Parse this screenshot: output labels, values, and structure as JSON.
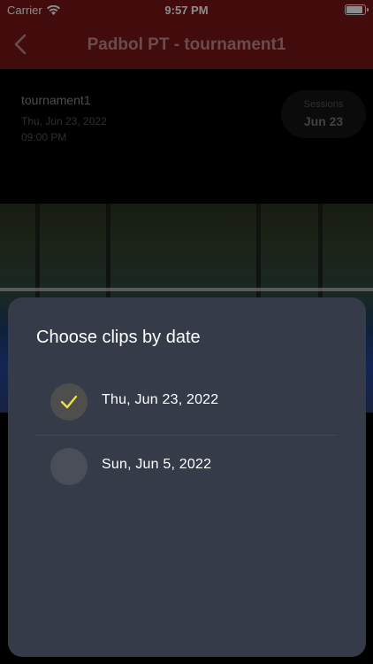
{
  "status_bar": {
    "carrier": "Carrier",
    "time": "9:57 PM"
  },
  "nav": {
    "title": "Padbol PT - tournament1"
  },
  "tournament": {
    "name": "tournament1",
    "date": "Thu, Jun 23, 2022",
    "time": "09:00 PM"
  },
  "sessions": {
    "label": "Sessions",
    "value": "Jun 23"
  },
  "modal": {
    "title": "Choose clips by date",
    "options": [
      {
        "date": "Thu, Jun 23, 2022",
        "selected": true
      },
      {
        "date": "Sun, Jun 5, 2022",
        "selected": false
      }
    ]
  },
  "colors": {
    "nav_bar": "#7a1616",
    "sheet": "#353b48",
    "check": "#f0e040"
  }
}
